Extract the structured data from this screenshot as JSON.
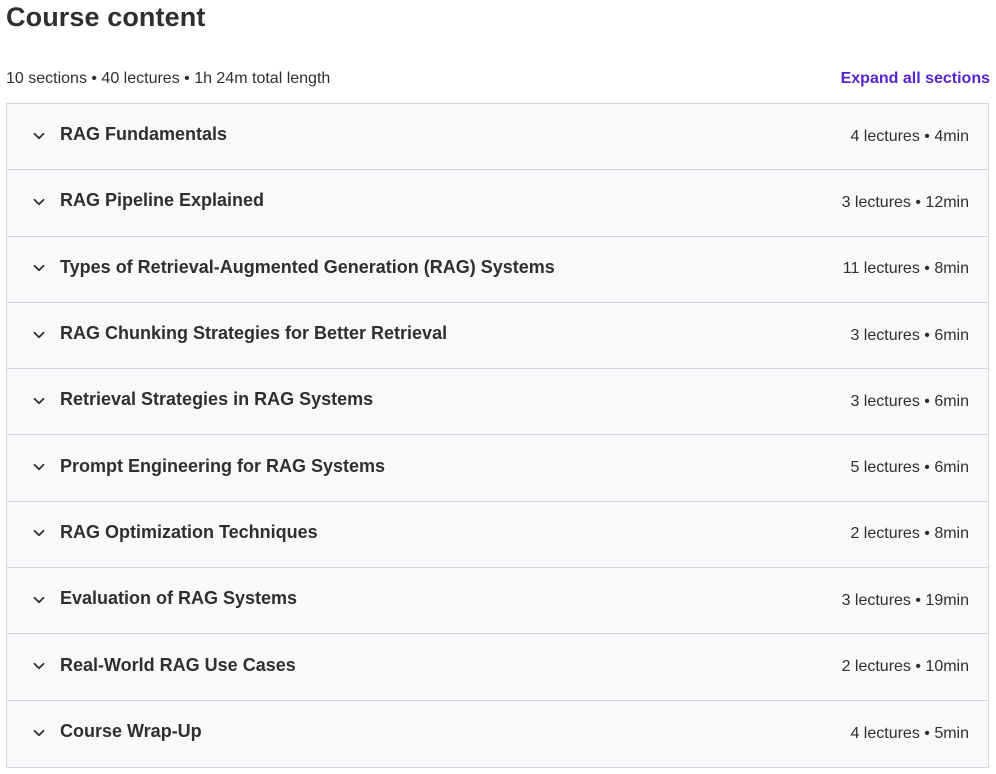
{
  "header": {
    "title": "Course content",
    "summary": "10 sections • 40 lectures • 1h 24m total length",
    "expand_all_label": "Expand all sections"
  },
  "colors": {
    "accent": "#5624d0",
    "text": "#2d2f31",
    "section_bg": "#f7f9fa",
    "border": "#d1d7dc"
  },
  "sections": [
    {
      "title": "RAG Fundamentals",
      "info": "4 lectures • 4min",
      "icon": "chevron-down-icon"
    },
    {
      "title": "RAG Pipeline Explained",
      "info": "3 lectures • 12min",
      "icon": "chevron-down-icon"
    },
    {
      "title": "Types of Retrieval-Augmented Generation (RAG) Systems",
      "info": "11 lectures • 8min",
      "icon": "chevron-down-icon"
    },
    {
      "title": "RAG Chunking Strategies for Better Retrieval",
      "info": "3 lectures • 6min",
      "icon": "chevron-down-icon"
    },
    {
      "title": "Retrieval Strategies in RAG Systems",
      "info": "3 lectures • 6min",
      "icon": "chevron-down-icon"
    },
    {
      "title": "Prompt Engineering for RAG Systems",
      "info": "5 lectures • 6min",
      "icon": "chevron-down-icon"
    },
    {
      "title": "RAG Optimization Techniques",
      "info": "2 lectures • 8min",
      "icon": "chevron-down-icon"
    },
    {
      "title": "Evaluation of RAG Systems",
      "info": "3 lectures • 19min",
      "icon": "chevron-down-icon"
    },
    {
      "title": "Real-World RAG Use Cases",
      "info": "2 lectures • 10min",
      "icon": "chevron-down-icon"
    },
    {
      "title": "Course Wrap-Up",
      "info": "4 lectures • 5min",
      "icon": "chevron-down-icon"
    }
  ]
}
